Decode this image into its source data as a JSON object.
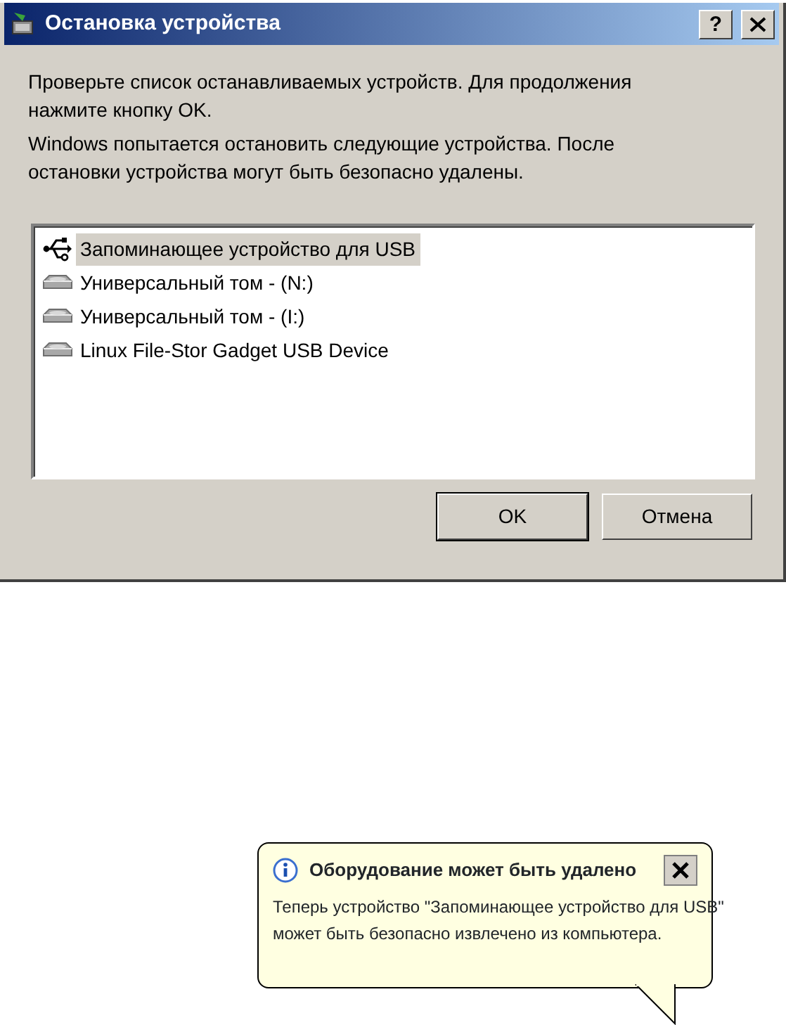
{
  "dialog": {
    "title": "Остановка устройства",
    "help_button": "?",
    "paragraphs": [
      {
        "lines": [
          "Проверьте список останавливаемых устройств. Для продолжения",
          "нажмите кнопку OK."
        ]
      },
      {
        "lines": [
          "Windows попытается остановить следующие устройства. После",
          "остановки устройства могут быть безопасно удалены."
        ]
      }
    ],
    "devices": [
      {
        "label": "Запоминающее устройство для USB",
        "kind": "usb",
        "selected": true
      },
      {
        "label": "Универсальный том - (N:)",
        "kind": "drive",
        "selected": false
      },
      {
        "label": "Универсальный том - (I:)",
        "kind": "drive",
        "selected": false
      },
      {
        "label": "Linux File-Stor Gadget USB Device",
        "kind": "drive",
        "selected": false
      }
    ],
    "buttons": [
      {
        "label": "OK",
        "default": true
      },
      {
        "label": "Отмена",
        "default": false
      }
    ]
  },
  "balloon": {
    "title": "Оборудование может быть удалено",
    "lines": [
      "Теперь устройство \"Запоминающее устройство для USB\"",
      "может быть безопасно извлечено из компьютера."
    ]
  }
}
